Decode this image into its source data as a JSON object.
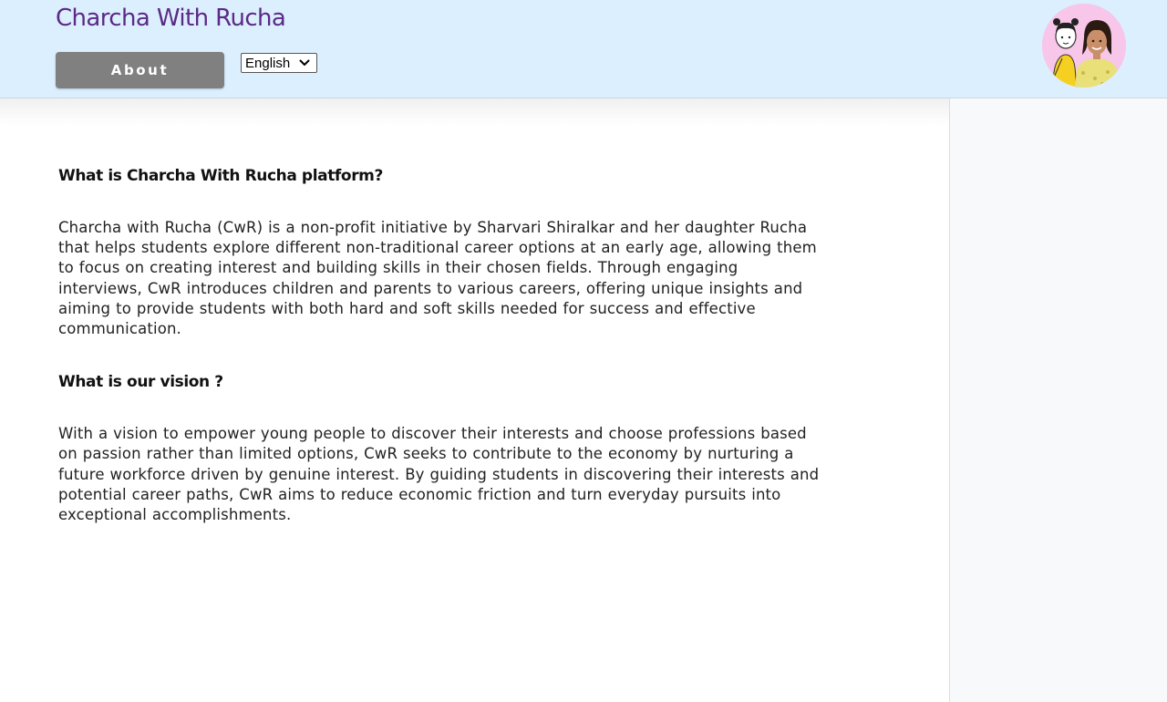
{
  "header": {
    "site_title": "Charcha With Rucha",
    "about_label": "About",
    "language": {
      "selected": "English",
      "icon": "chevron-down-icon"
    },
    "avatar_icon": "avatar-illustration"
  },
  "main": {
    "sections": [
      {
        "heading": "What is Charcha With Rucha platform?",
        "body": "Charcha with Rucha (CwR) is a non-profit initiative by Sharvari Shiralkar and her daughter Rucha that helps students explore different non-traditional career options at an early age, allowing them to focus on creating interest and building skills in their chosen fields. Through engaging interviews, CwR introduces children and parents to various careers, offering unique insights and aiming to provide students with both hard and soft skills needed for success and effective communication."
      },
      {
        "heading": "What is our vision ?",
        "body": "With a vision to empower young people to discover their interests and choose professions based on passion rather than limited options, CwR seeks to contribute to the economy by nurturing a future workforce driven by genuine interest. By guiding students in discovering their interests and potential career paths, CwR aims to reduce economic friction and turn everyday pursuits into exceptional accomplishments."
      }
    ]
  },
  "colors": {
    "header_bg": "#dcefff",
    "title": "#5b2a86",
    "about_button": "#808080",
    "sidebar_bg": "#f8f9fb"
  }
}
